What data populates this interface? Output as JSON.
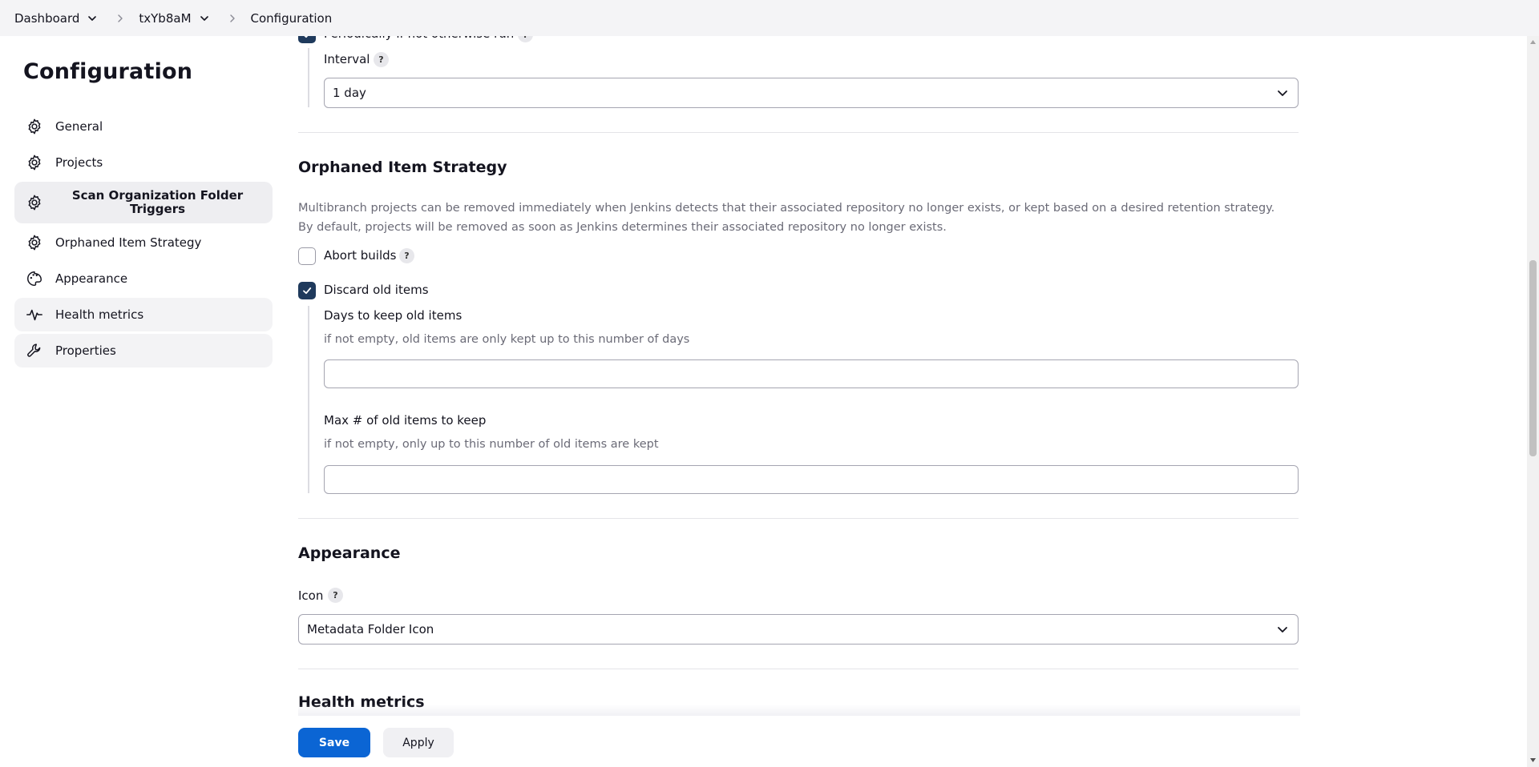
{
  "breadcrumb": {
    "items": [
      "Dashboard",
      "txYb8aM",
      "Configuration"
    ]
  },
  "sidebar": {
    "title": "Configuration",
    "items": [
      {
        "label": "General",
        "icon": "gear-icon"
      },
      {
        "label": "Projects",
        "icon": "gear-icon"
      },
      {
        "label": "Scan Organization Folder Triggers",
        "icon": "gear-icon"
      },
      {
        "label": "Orphaned Item Strategy",
        "icon": "gear-icon"
      },
      {
        "label": "Appearance",
        "icon": "palette-icon"
      },
      {
        "label": "Health metrics",
        "icon": "pulse-icon"
      },
      {
        "label": "Properties",
        "icon": "wrench-icon"
      }
    ]
  },
  "triggers": {
    "periodic_label": "Periodically if not otherwise run",
    "periodic_checked": true,
    "interval_label": "Interval",
    "interval_value": "1 day"
  },
  "orphaned": {
    "title": "Orphaned Item Strategy",
    "description": "Multibranch projects can be removed immediately when Jenkins detects that their associated repository no longer exists, or kept based on a desired retention strategy. By default, projects will be removed as soon as Jenkins determines their associated repository no longer exists.",
    "abort_builds_label": "Abort builds",
    "abort_builds_checked": false,
    "discard_label": "Discard old items",
    "discard_checked": true,
    "days_label": "Days to keep old items",
    "days_hint": "if not empty, old items are only kept up to this number of days",
    "days_value": "",
    "max_label": "Max # of old items to keep",
    "max_hint": "if not empty, only up to this number of old items are kept",
    "max_value": ""
  },
  "appearance": {
    "title": "Appearance",
    "icon_label": "Icon",
    "icon_value": "Metadata Folder Icon"
  },
  "health": {
    "title": "Health metrics"
  },
  "actions": {
    "save_label": "Save",
    "apply_label": "Apply"
  },
  "help_glyph": "?",
  "colors": {
    "primary_button": "#0b65d4",
    "checkbox_checked": "#1f3a5c",
    "active_sidebar_bg": "#eeeef1"
  }
}
